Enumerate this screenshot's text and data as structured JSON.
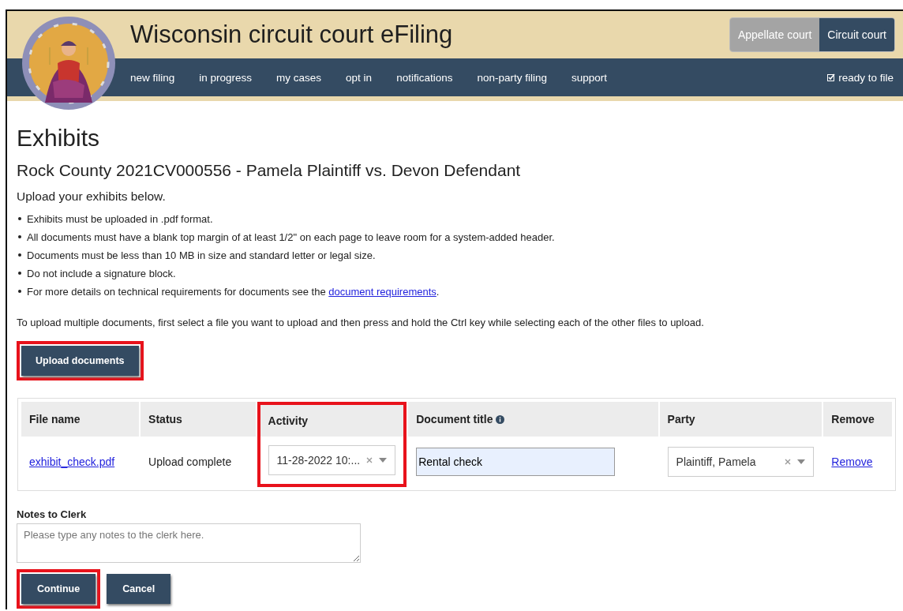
{
  "header": {
    "title": "Wisconsin circuit court eFiling",
    "court_switch": [
      {
        "label": "Appellate court",
        "selected": false
      },
      {
        "label": "Circuit court",
        "selected": true
      }
    ],
    "nav": [
      "new filing",
      "in progress",
      "my cases",
      "opt in",
      "notifications",
      "non-party filing",
      "support"
    ],
    "ready_to_file": {
      "label": "ready to file",
      "checked": true
    }
  },
  "page": {
    "title": "Exhibits",
    "case_title": "Rock County 2021CV000556 - Pamela Plaintiff vs. Devon Defendant",
    "intro": "Upload your exhibits below.",
    "bullets": [
      "Exhibits must be uploaded in .pdf format.",
      "All documents must have a blank top margin of at least 1/2\" on each page to leave room for a system-added header.",
      "Documents must be less than 10 MB in size and standard letter or legal size.",
      "Do not include a signature block."
    ],
    "last_bullet": {
      "text": "For more details on technical requirements for documents see the ",
      "link": "document requirements",
      "after": "."
    },
    "multi_note": "To upload multiple documents, first select a file you want to upload and then press and hold the Ctrl key while selecting each of the other files to upload.",
    "upload_button": {
      "label": "Upload documents",
      "highlighted": true
    }
  },
  "table": {
    "columns": [
      {
        "label": "File name",
        "highlighted": false
      },
      {
        "label": "Status",
        "highlighted": false
      },
      {
        "label": "Activity",
        "highlighted": true
      },
      {
        "label": "Document title",
        "highlighted": false,
        "info": true
      },
      {
        "label": "Party",
        "highlighted": false
      },
      {
        "label": "Remove",
        "highlighted": false
      }
    ],
    "rows": [
      {
        "file": "exhibit_check.pdf",
        "status": "Upload complete",
        "activity": "11-28-2022 10:...",
        "document_title": "Rental check",
        "party": "Plaintiff, Pamela",
        "remove": "Remove"
      }
    ]
  },
  "notes": {
    "label": "Notes to Clerk",
    "placeholder": "Please type any notes to the clerk here."
  },
  "buttons": [
    {
      "label": "Continue",
      "highlighted": true
    },
    {
      "label": "Cancel",
      "highlighted": false
    }
  ]
}
